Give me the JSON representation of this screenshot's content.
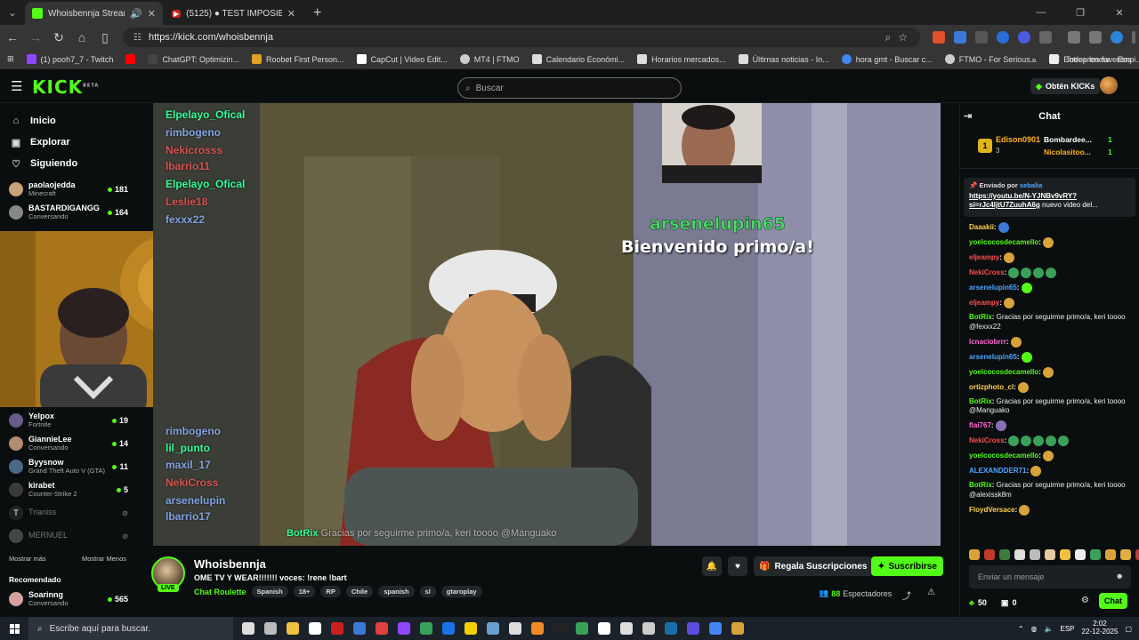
{
  "browser": {
    "tabs": [
      {
        "title": "Whoisbennja Stream - Watc",
        "active": true,
        "favicon_color": "#53fc18"
      },
      {
        "title": "TEST IMPOSIBLE: Ad",
        "badge": "(5125)",
        "active": false,
        "favicon_color": "#ff0000"
      }
    ],
    "url": "https://kick.com/whoisbennja",
    "bookmarks": [
      {
        "label": "(1) pooh7_7 - Twitch",
        "color": "#9146ff"
      },
      {
        "label": "",
        "color": "#ff0000"
      },
      {
        "label": "ChatGPT: Optimizin...",
        "color": "#444444"
      },
      {
        "label": "Roobet First Person...",
        "color": "#e0a020"
      },
      {
        "label": "CapCut | Video Edit...",
        "color": "#ffffff"
      },
      {
        "label": "MT4 | FTMO",
        "color": "#cccccc"
      },
      {
        "label": "Calendario Económi...",
        "color": "#dddddd"
      },
      {
        "label": "Horarios mercados...",
        "color": "#dddddd"
      },
      {
        "label": "Últimas noticias - In...",
        "color": "#dddddd"
      },
      {
        "label": "hora gmt - Buscar c...",
        "color": "#4285f4"
      },
      {
        "label": "FTMO - For Serious...",
        "color": "#cccccc"
      },
      {
        "label": "Entrepreneur - Empi...",
        "color": "#eeeeee"
      }
    ],
    "bookmarks_all": "Todos los favoritos"
  },
  "kick": {
    "logo": "KICK",
    "logo_beta": "BETA",
    "search_placeholder": "Buscar",
    "kicks_button": "Obtén KICKs",
    "accent": "#53fc18"
  },
  "sidebar": {
    "nav": [
      {
        "label": "Inicio",
        "icon": "home-icon",
        "glyph": "⌂"
      },
      {
        "label": "Explorar",
        "icon": "compass-icon",
        "glyph": "▣"
      },
      {
        "label": "Siguiendo",
        "icon": "heart-icon",
        "glyph": "♡"
      }
    ],
    "following": [
      {
        "name": "paolaojedda",
        "category": "Minecraft",
        "viewers": "181",
        "color": "#c9a27a",
        "offline": false
      },
      {
        "name": "BASTARDIGANGG",
        "category": "Conversando",
        "viewers": "164",
        "color": "#888888",
        "offline": false
      },
      {
        "name": "Yelpox",
        "category": "Fortnite",
        "viewers": "19",
        "color": "#6b5a8e",
        "offline": false
      },
      {
        "name": "GiannieLee",
        "category": "Conversando",
        "viewers": "14",
        "color": "#b48c6e",
        "offline": false
      },
      {
        "name": "Byysnow",
        "category": "Grand Theft Auto V (GTA)",
        "viewers": "11",
        "color": "#4a6a8a",
        "offline": false
      },
      {
        "name": "kirabet",
        "category": "Counter-Strike 2",
        "viewers": "5",
        "color": "#3a3a3a",
        "offline": false
      },
      {
        "name": "Trianiss",
        "category": "",
        "viewers": "",
        "color": "#222222",
        "offline": true
      },
      {
        "name": "MERNUEL",
        "category": "",
        "viewers": "",
        "color": "#444444",
        "offline": true
      }
    ],
    "show_more": "Mostrar más",
    "show_less": "Mostrar Menos",
    "recommended_title": "Recomendado",
    "recommended": [
      {
        "name": "Soarinng",
        "category": "Conversando",
        "viewers": "565",
        "color": "#d6a0a0",
        "offline": false
      }
    ]
  },
  "video": {
    "overlay_chat": [
      {
        "text": "Elpelayo_Ofical",
        "style": "green"
      },
      {
        "text": "rimbogeno",
        "style": "dim"
      },
      {
        "text": "Nekicrosss",
        "style": "red"
      },
      {
        "text": "lbarrio11",
        "style": "red"
      },
      {
        "text": "Elpelayo_Ofical",
        "style": "green"
      },
      {
        "text": "Leslie18",
        "style": "red"
      },
      {
        "text": "fexxx22",
        "style": "dim"
      },
      {
        "text": "rimbogeno",
        "style": "dim"
      },
      {
        "text": "lil_punto",
        "style": "green"
      },
      {
        "text": "maxil_17",
        "style": "dim"
      },
      {
        "text": "NekiCross",
        "style": "red"
      },
      {
        "text": "arsenelupin",
        "style": "dim"
      },
      {
        "text": "lbarrio17",
        "style": "dim"
      }
    ],
    "welcome_user": "arsenelupin65",
    "welcome_message": "Bienvenido primo/a!",
    "bot_name": "BotRix",
    "bot_text": "Gracias por seguirme primo/a, keri toooo @Manguako"
  },
  "stream": {
    "streamer": "Whoisbennja",
    "live_label": "LIVE",
    "title": "OME TV Y WEAR!!!!!!!   voces: !rene !bart",
    "category": "Chat Roulette",
    "tags": [
      "Spanish",
      "18+",
      "RP",
      "Chile",
      "spanish",
      "sl",
      "gtaroplay"
    ],
    "gift_label": "Regala Suscripciones",
    "subscribe_label": "Suscribirse",
    "viewers": "88",
    "viewers_label": "Espectadores"
  },
  "chat": {
    "title": "Chat",
    "leaderboard": {
      "rank": "1",
      "top_user": "Edison0901",
      "top_count": "3",
      "right": [
        {
          "name": "Bombardee...",
          "count": "1"
        },
        {
          "name": "Nicolasitoo...",
          "count": "1"
        }
      ]
    },
    "pinned": {
      "by_label": "Enviado por",
      "by_user": "sebalia",
      "link": "https://youtu.be/N-YJNBv9vRY?si=rJc4ljtU7ZuuhA6g",
      "rest": "nuevo video del..."
    },
    "messages": [
      {
        "user": "Daaakii",
        "color": "#ffd24d",
        "text": "",
        "emotes": [
          "#3b7ad9"
        ]
      },
      {
        "user": "yoelcocosdecamello",
        "color": "#53fc18",
        "text": "",
        "emotes": [
          "#d9a33b"
        ]
      },
      {
        "user": "eljeampy",
        "color": "#ff4d4d",
        "text": "",
        "emotes": [
          "#d9a33b"
        ]
      },
      {
        "user": "NekiCross",
        "color": "#ff4d4d",
        "text": "",
        "emotes": [
          "#3aa05a",
          "#3aa05a",
          "#3aa05a",
          "#3aa05a"
        ]
      },
      {
        "user": "arsenelupin65",
        "color": "#4da6ff",
        "text": "",
        "emotes": [
          "#53fc18"
        ]
      },
      {
        "user": "eljeampy",
        "color": "#ff4d4d",
        "text": "",
        "emotes": [
          "#d9a33b"
        ]
      },
      {
        "user": "BotRix",
        "color": "#53fc18",
        "text": "Gracias por seguirme primo/a, keri toooo @fexxx22",
        "emotes": []
      },
      {
        "user": "lcnaciobrrr",
        "color": "#ff6ad5",
        "text": "",
        "emotes": [
          "#d9a33b"
        ]
      },
      {
        "user": "arsenelupin65",
        "color": "#4da6ff",
        "text": "",
        "emotes": [
          "#53fc18"
        ]
      },
      {
        "user": "yoelcocosdecamello",
        "color": "#53fc18",
        "text": "",
        "emotes": [
          "#d9a33b"
        ]
      },
      {
        "user": "ortizphoto_cl",
        "color": "#ffd24d",
        "text": "",
        "emotes": [
          "#d9a33b"
        ]
      },
      {
        "user": "BotRix",
        "color": "#53fc18",
        "text": "Gracias por seguirme primo/a, keri toooo @Manguako",
        "emotes": []
      },
      {
        "user": "flai767",
        "color": "#ff6ad5",
        "text": "",
        "emotes": [
          "#8a6fb8"
        ]
      },
      {
        "user": "NekiCross",
        "color": "#ff4d4d",
        "text": "",
        "emotes": [
          "#3aa05a",
          "#3aa05a",
          "#3aa05a",
          "#3aa05a",
          "#3aa05a"
        ]
      },
      {
        "user": "yoelcocosdecamello",
        "color": "#53fc18",
        "text": "",
        "emotes": [
          "#d9a33b"
        ]
      },
      {
        "user": "ALEXANDDER71",
        "color": "#4da6ff",
        "text": "",
        "emotes": [
          "#d9a33b"
        ]
      },
      {
        "user": "BotRix",
        "color": "#53fc18",
        "text": "Gracias por seguirme primo/a, keri toooo @alexissk8m",
        "emotes": []
      },
      {
        "user": "FloydVersace",
        "color": "#ffd24d",
        "text": "",
        "emotes": [
          "#d9a33b"
        ]
      }
    ],
    "emote_bar": [
      "#d9a33b",
      "#c0392b",
      "#3a7a3a",
      "#dddddd",
      "#bbbbbb",
      "#e8c9a0",
      "#f0c040",
      "#eeeeee",
      "#3aa05a",
      "#d9a33b",
      "#e0b040",
      "#c04040"
    ],
    "input_placeholder": "Enviar un mensaje",
    "kicks_count": "50",
    "gift_count": "0",
    "send_label": "Chat"
  },
  "taskbar": {
    "search_placeholder": "Escribe aquí para buscar.",
    "apps": [
      "#dddddd",
      "#bbbbbb",
      "#f0c040",
      "#ffffff",
      "#cc1f1f",
      "#3b7ad9",
      "#e04040",
      "#9146ff",
      "#3aa05a",
      "#1a73e8",
      "#f5d000",
      "#6aa0d0",
      "#dddddd",
      "#f08a24",
      "#222222",
      "#3aa05a",
      "#ffffff",
      "#dddddd",
      "#cccccc",
      "#1b6ea8",
      "#5a4ee0",
      "#4285f4",
      "#d9a33b"
    ],
    "language": "ESP",
    "time": "2:02",
    "date": "22-12-2025"
  }
}
